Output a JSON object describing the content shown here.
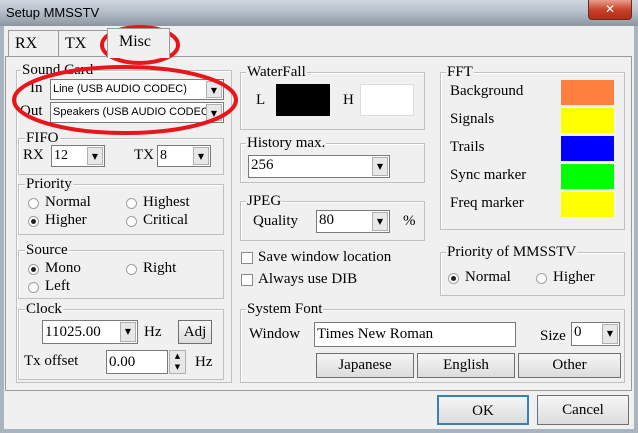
{
  "window": {
    "title": "Setup MMSSTV",
    "close_icon": "close-icon"
  },
  "tabs": [
    {
      "label": "RX"
    },
    {
      "label": "TX"
    },
    {
      "label": "Misc",
      "selected": true
    }
  ],
  "sound_card": {
    "label": "Sound Card",
    "in_label": "In",
    "in_value": "Line (USB AUDIO  CODEC)",
    "out_label": "Out",
    "out_value": "Speakers (USB AUDIO  CODEC)"
  },
  "fifo": {
    "label": "FIFO",
    "rx_label": "RX",
    "rx_value": "12",
    "tx_label": "TX",
    "tx_value": "8"
  },
  "priority": {
    "label": "Priority",
    "options": [
      "Normal",
      "Highest",
      "Higher",
      "Critical"
    ],
    "selected": "Higher"
  },
  "source": {
    "label": "Source",
    "options": [
      "Mono",
      "Right",
      "Left"
    ],
    "selected": "Mono"
  },
  "clock": {
    "label": "Clock",
    "value": "11025.00",
    "unit": "Hz",
    "adj_label": "Adj",
    "tx_offset_label": "Tx offset",
    "tx_offset_value": "0.00",
    "tx_offset_unit": "Hz"
  },
  "waterfall": {
    "label": "WaterFall",
    "l_label": "L",
    "l_color": "#000000",
    "h_label": "H",
    "h_color": "#ffffff"
  },
  "history": {
    "label": "History max.",
    "value": "256"
  },
  "jpeg": {
    "label": "JPEG",
    "quality_label": "Quality",
    "quality_value": "80",
    "unit": "%"
  },
  "checkboxes": [
    {
      "label": "Save window location",
      "checked": false
    },
    {
      "label": "Always use DIB",
      "checked": false
    }
  ],
  "fft": {
    "label": "FFT",
    "items": [
      {
        "label": "Background",
        "color": "#ff7f3f"
      },
      {
        "label": "Signals",
        "color": "#ffff00"
      },
      {
        "label": "Trails",
        "color": "#0000ff"
      },
      {
        "label": "Sync marker",
        "color": "#00ff00"
      },
      {
        "label": "Freq marker",
        "color": "#ffff00"
      }
    ]
  },
  "priority_mmsstv": {
    "label": "Priority of MMSSTV",
    "options": [
      "Normal",
      "Higher"
    ],
    "selected": "Normal"
  },
  "system_font": {
    "label": "System Font",
    "window_label": "Window",
    "window_value": "Times New Roman",
    "size_label": "Size",
    "size_value": "0",
    "buttons": [
      "Japanese",
      "English",
      "Other"
    ]
  },
  "footer": {
    "ok_label": "OK",
    "cancel_label": "Cancel"
  },
  "annotation_color": "#e8151b"
}
